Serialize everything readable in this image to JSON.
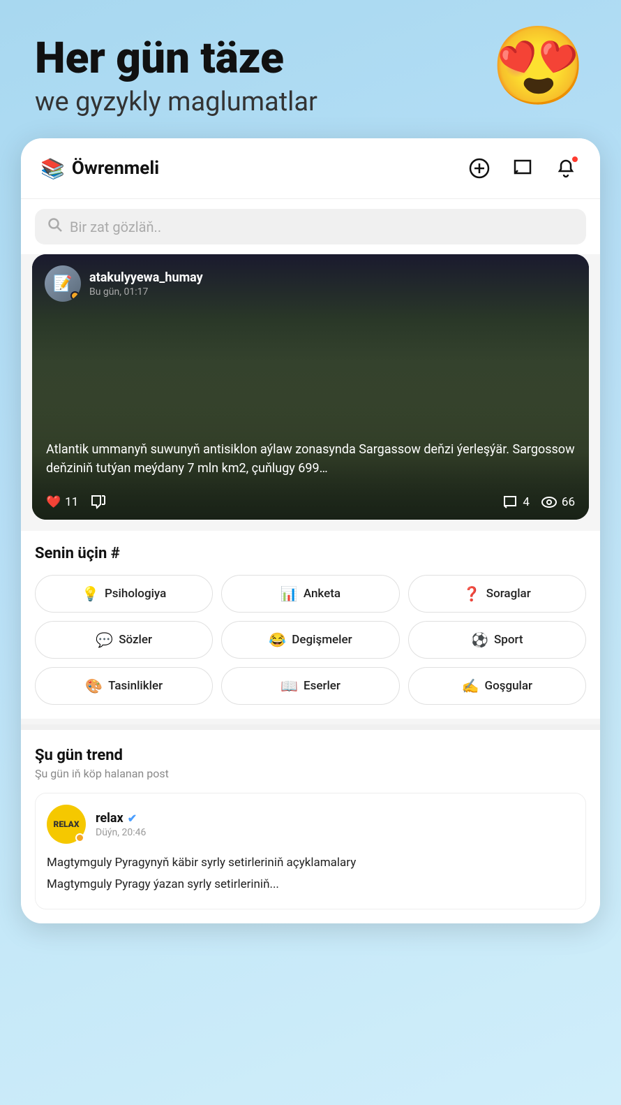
{
  "hero": {
    "title": "Her gün täze",
    "subtitle": "we gyzykly maglumatlar",
    "emoji": "😍"
  },
  "header": {
    "logo_emoji": "📚",
    "app_name": "Öwrenmeli",
    "add_icon": "+",
    "chat_icon": "💬",
    "bell_icon": "🔔"
  },
  "search": {
    "placeholder": "Bir zat gözläň.."
  },
  "post": {
    "username": "atakulyyewa_humay",
    "timestamp": "Bu gün, 01:17",
    "text": "Atlantik ummanyň suwunyň antisiklon aýlaw zonasynda Sargassow deňzi ýerleşýär. Sargossow deňziniň tutýan meýdany 7 mln km2, çuňlugy 699…",
    "likes": "11",
    "comments": "4",
    "views": "66"
  },
  "tags_section": {
    "title": "Senin üçin #",
    "tags": [
      {
        "emoji": "💡",
        "label": "Psihologiya"
      },
      {
        "emoji": "📊",
        "label": "Anketa"
      },
      {
        "emoji": "❓",
        "label": "Soraglar"
      },
      {
        "emoji": "💬",
        "label": "Sözler"
      },
      {
        "emoji": "😂",
        "label": "Degişmeler"
      },
      {
        "emoji": "⚽",
        "label": "Sport"
      },
      {
        "emoji": "🎨",
        "label": "Tasinlikler"
      },
      {
        "emoji": "📖",
        "label": "Eserler"
      },
      {
        "emoji": "✍️",
        "label": "Goşgular"
      }
    ]
  },
  "trend_section": {
    "title": "Şu gün trend",
    "subtitle": "Şu gün iň köp halanan post",
    "post": {
      "avatar_text": "RELAX",
      "username": "relax",
      "verified": true,
      "timestamp": "Düýn, 20:46",
      "line1": "Magtymguly Pyragynyň käbir syrly setirleriniň açyklamalary",
      "line2": "Magtymguly Pyragy ýazan syrly setirleriniň..."
    }
  }
}
